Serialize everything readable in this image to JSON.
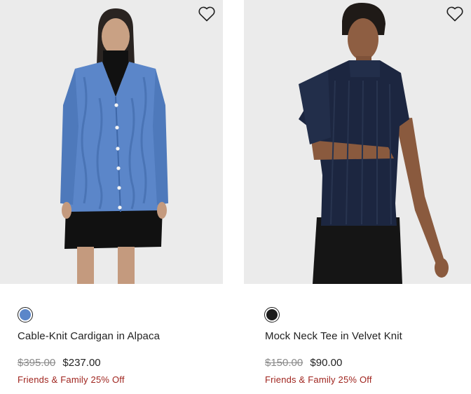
{
  "products": [
    {
      "name": "Cable-Knit Cardigan in Alpaca",
      "original_price": "$395.00",
      "sale_price": "$237.00",
      "promo": "Friends & Family 25% Off",
      "swatch_color": "#5b86c9",
      "wishlist_icon": "heart-outline-icon"
    },
    {
      "name": "Mock Neck Tee in Velvet Knit",
      "original_price": "$150.00",
      "sale_price": "$90.00",
      "promo": "Friends & Family 25% Off",
      "swatch_color": "#1c1c1c",
      "wishlist_icon": "heart-outline-icon"
    }
  ],
  "colors": {
    "promo_text": "#a0251f",
    "strike_price": "#8a8a8a",
    "image_bg": "#ececec"
  }
}
